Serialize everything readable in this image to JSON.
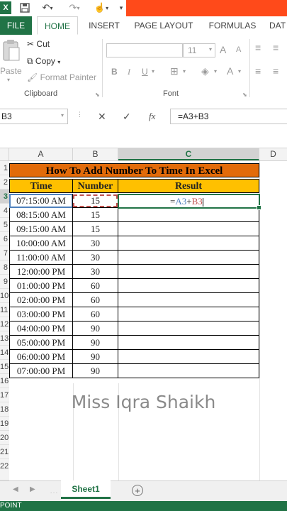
{
  "titlebar": {
    "app_icon": "X"
  },
  "tabs": [
    "FILE",
    "HOME",
    "INSERT",
    "PAGE LAYOUT",
    "FORMULAS",
    "DAT"
  ],
  "clipboard": {
    "paste": "Paste",
    "cut": "Cut",
    "copy": "Copy",
    "format_painter": "Format Painter",
    "label": "Clipboard"
  },
  "font": {
    "size": "11",
    "grow": "A",
    "shrink": "A",
    "bold": "B",
    "italic": "I",
    "underline": "U",
    "font_color": "A",
    "label": "Font"
  },
  "formula_bar": {
    "name_box": "B3",
    "cancel": "✕",
    "enter": "✓",
    "fx": "fx",
    "formula": "=A3+B3"
  },
  "columns": [
    "A",
    "B",
    "C",
    "D"
  ],
  "row_numbers": [
    "1",
    "2",
    "3",
    "4",
    "5",
    "6",
    "7",
    "8",
    "9",
    "10",
    "11",
    "12",
    "13",
    "14",
    "15",
    "16",
    "17",
    "18",
    "19",
    "20",
    "21",
    "22"
  ],
  "sheet": {
    "title": "How  To Add Number To Time In Excel",
    "headers": {
      "time": "Time",
      "number": "Number",
      "result": "Result"
    },
    "rows": [
      {
        "time": "07:15:00 AM",
        "number": "15"
      },
      {
        "time": "08:15:00 AM",
        "number": "15"
      },
      {
        "time": "09:15:00 AM",
        "number": "15"
      },
      {
        "time": "10:00:00 AM",
        "number": "30"
      },
      {
        "time": "11:00:00 AM",
        "number": "30"
      },
      {
        "time": "12:00:00 PM",
        "number": "30"
      },
      {
        "time": "01:00:00 PM",
        "number": "60"
      },
      {
        "time": "02:00:00 PM",
        "number": "60"
      },
      {
        "time": "03:00:00 PM",
        "number": "60"
      },
      {
        "time": "04:00:00 PM",
        "number": "90"
      },
      {
        "time": "05:00:00 PM",
        "number": "90"
      },
      {
        "time": "06:00:00 PM",
        "number": "90"
      },
      {
        "time": "07:00:00 PM",
        "number": "90"
      }
    ],
    "edit_formula": {
      "eq": "=",
      "ref1": "A3",
      "plus": "+",
      "ref2": "B3"
    }
  },
  "watermark": "Miss Iqra Shaikh",
  "sheet_tab": "Sheet1",
  "add_sheet": "+",
  "status": "POINT",
  "colors": {
    "excel_green": "#217346",
    "title_fill": "#e26b0a",
    "header_fill": "#ffc000",
    "ref_blue": "#4f81bd",
    "ref_red": "#c0504d"
  }
}
